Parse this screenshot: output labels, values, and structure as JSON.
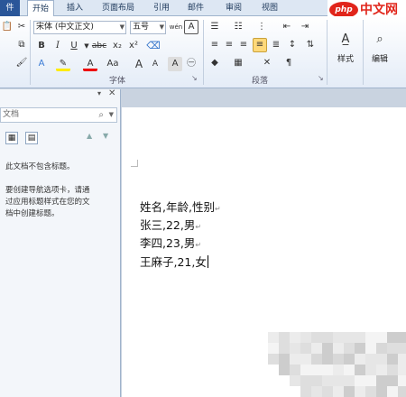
{
  "tabs": {
    "file": "件",
    "home": "开始",
    "insert": "插入",
    "page_layout": "页面布局",
    "references": "引用",
    "mailings": "邮件",
    "review": "审阅",
    "view": "视图"
  },
  "ribbon": {
    "font_name": "宋体 (中文正文)",
    "font_size": "五号",
    "group_font": "字体",
    "group_paragraph": "段落",
    "styles_label": "样式",
    "editing_label": "编辑",
    "bold": "B",
    "italic": "I",
    "underline": "U",
    "strike": "abc",
    "subscript": "x₂",
    "superscript": "x²",
    "font_color": "A",
    "change_case": "Aa",
    "grow": "A",
    "shrink": "A",
    "char_border": "A",
    "phonetic": "wén",
    "clear_format": "A",
    "text_effect": "A",
    "enclose": "㊀"
  },
  "nav": {
    "search_placeholder": "文档",
    "message_line1": "此文档不包含标题。",
    "message_line2": "要创建导航选项卡，请通",
    "message_line3": "过应用标题样式在您的文",
    "message_line4": "档中创建标题。"
  },
  "document": {
    "lines": [
      "姓名,年龄,性别",
      "张三,22,男",
      "李四,23,男",
      "王麻子,21,女"
    ],
    "para_mark": "↵"
  },
  "watermark": {
    "logo": "php",
    "text": "中文网"
  },
  "colors": {
    "accent": "#2a5699",
    "ribbon_bg": "#e4ecf7",
    "highlight": "#ffd97a",
    "watermark_red": "#e1251b"
  }
}
